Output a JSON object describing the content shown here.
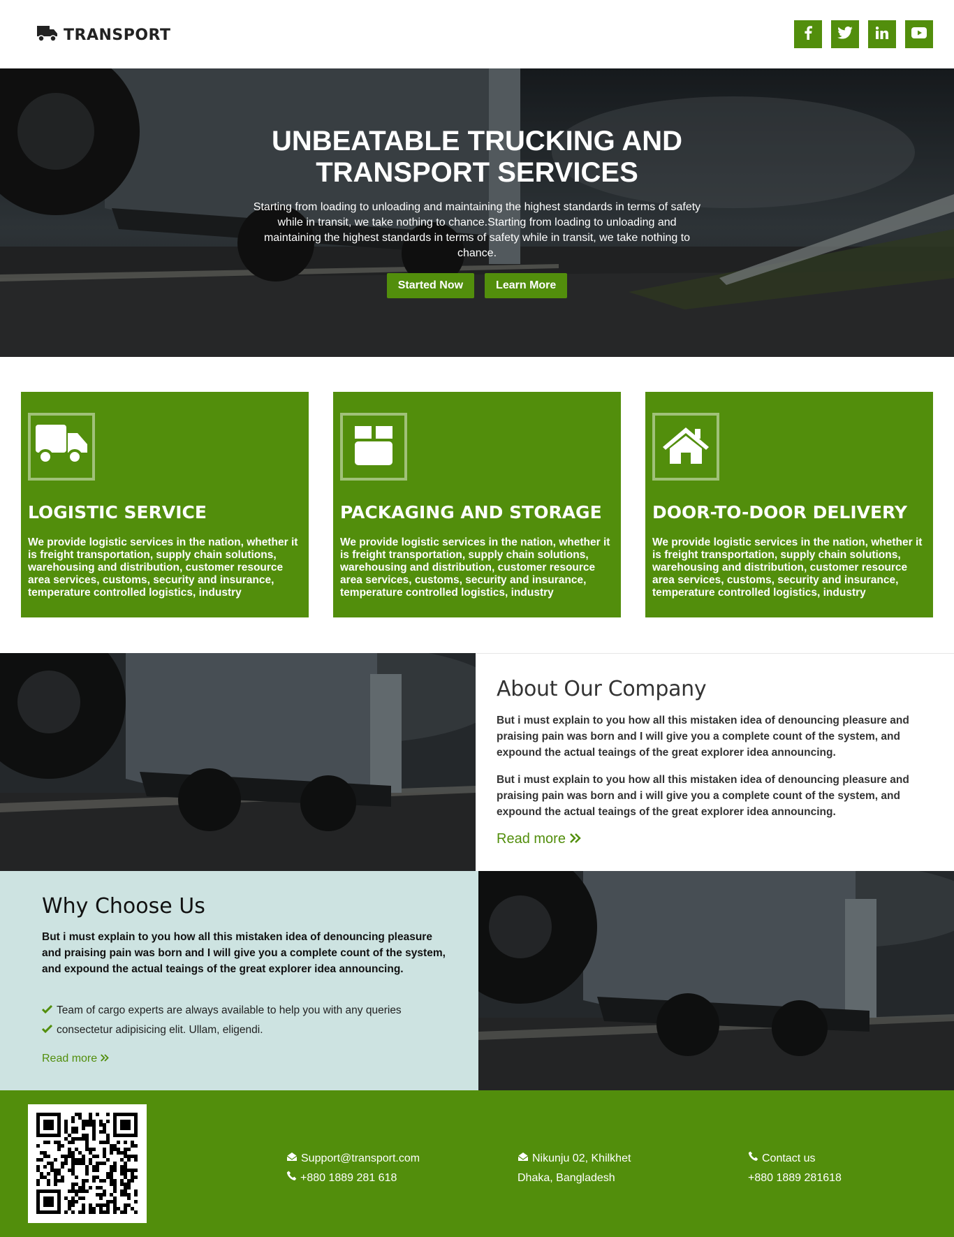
{
  "header": {
    "logo_text": "TRANSPORT",
    "social": [
      "facebook-icon",
      "twitter-icon",
      "linkedin-icon",
      "youtube-icon"
    ]
  },
  "hero": {
    "title_line1": "UNBEATABLE TRUCKING AND",
    "title_line2": "TRANSPORT SERVICES",
    "description": "Starting from loading to unloading and maintaining the highest standards in terms of safety while in transit, we take nothing to chance.Starting from loading to unloading and maintaining the highest standards in terms of safety while in transit, we take nothing to chance.",
    "btn_primary": "Started Now",
    "btn_secondary": "Learn More"
  },
  "services": [
    {
      "icon": "truck-icon",
      "title": "LOGISTIC SERVICE",
      "desc": "We provide logistic services in the nation, whether it is freight transportation, supply chain solutions, warehousing and distribution, customer resource area services, customs, security and insurance, temperature controlled logistics, industry"
    },
    {
      "icon": "box-icon",
      "title": "PACKAGING AND STORAGE",
      "desc": "We provide logistic services in the nation, whether it is freight transportation, supply chain solutions, warehousing and distribution, customer resource area services, customs, security and insurance, temperature controlled logistics, industry"
    },
    {
      "icon": "home-icon",
      "title": "DOOR-TO-DOOR DELIVERY",
      "desc": "We provide logistic services in the nation, whether it is freight transportation, supply chain solutions, warehousing and distribution, customer resource area services, customs, security and insurance, temperature controlled logistics, industry"
    }
  ],
  "about": {
    "title": "About Our Company",
    "p1": "But i must explain to you how all this mistaken idea of denouncing pleasure and praising pain was born and I will give you a complete count of the system, and expound the actual teaings of the great explorer idea announcing.",
    "p2": "But i must explain to you how all this mistaken idea of denouncing pleasure and praising pain was born and i will give you a complete count of the system, and expound the actual teaings of the great explorer idea announcing.",
    "read_more": "Read more"
  },
  "why": {
    "title": "Why Choose Us",
    "p": "But i must explain to you how all this mistaken idea of denouncing pleasure and praising pain was born and I will give you a complete count of the system, and expound the actual teaings of the great explorer idea announcing.",
    "items": [
      "Team of cargo experts are always available to help you with any queries",
      "consectetur adipisicing elit. Ullam, eligendi."
    ],
    "read_more": "Read more"
  },
  "footer": {
    "email": "Support@transport.com",
    "phone1": "+880 1889 281 618",
    "address1": "Nikunju 02, Khilkhet",
    "address2": "Dhaka, Bangladesh",
    "contact_label": "Contact us",
    "phone2": "+880 1889 281618"
  },
  "colors": {
    "accent": "#528e0c",
    "why_bg": "#cde3e1"
  }
}
